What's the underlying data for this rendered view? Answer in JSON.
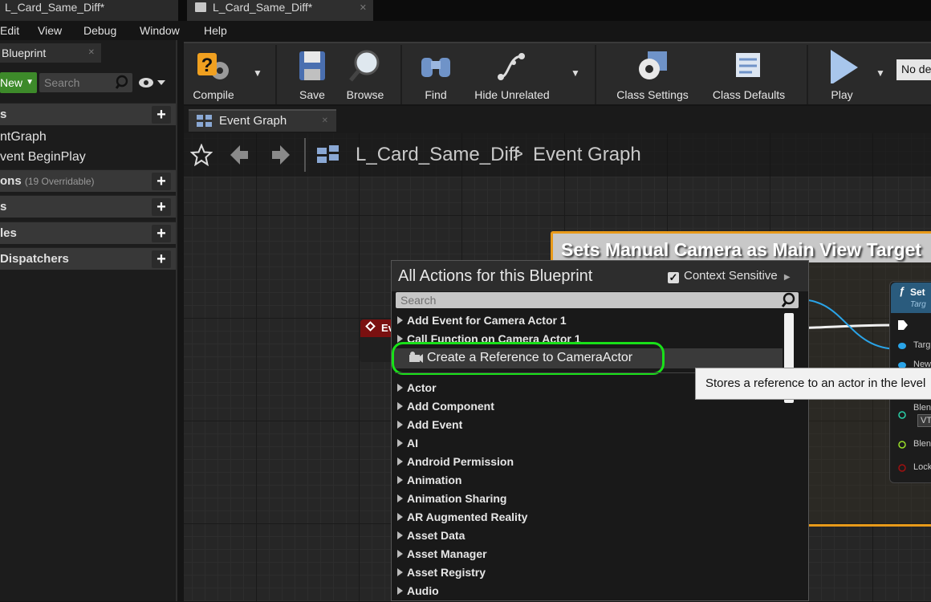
{
  "doc_tabs": [
    {
      "label": "L_Card_Same_Diff*"
    },
    {
      "label": "L_Card_Same_Diff*"
    }
  ],
  "menu": [
    "Edit",
    "View",
    "Debug",
    "Window",
    "Help"
  ],
  "left_panel": {
    "tab_label": "Blueprint",
    "new_label": "New",
    "search_placeholder": "Search",
    "sections": [
      {
        "label": "s"
      },
      {
        "label": "ons",
        "sub": "(19 Overridable)"
      },
      {
        "label": "s"
      },
      {
        "label": "les"
      },
      {
        "label": "Dispatchers"
      }
    ],
    "graph_items": [
      "ntGraph",
      "vent BeginPlay"
    ]
  },
  "toolbar": {
    "buttons": [
      {
        "label": "Compile",
        "icon": "compile-icon"
      },
      {
        "label": "Save",
        "icon": "save-icon"
      },
      {
        "label": "Browse",
        "icon": "browse-icon"
      },
      {
        "label": "Find",
        "icon": "find-icon"
      },
      {
        "label": "Hide Unrelated",
        "icon": "hide-unrelated-icon"
      },
      {
        "label": "Class Settings",
        "icon": "class-settings-icon"
      },
      {
        "label": "Class Defaults",
        "icon": "class-defaults-icon"
      },
      {
        "label": "Play",
        "icon": "play-icon"
      }
    ],
    "debug_filter": "No de"
  },
  "graph_tab": {
    "label": "Event Graph"
  },
  "breadcrumb": {
    "root": "L_Card_Same_Diff",
    "separator": ">",
    "current": "Event Graph"
  },
  "graph": {
    "comment_title": "Sets Manual Camera as Main View Target",
    "event_node_label": "Ev",
    "set_node": {
      "title": "Set",
      "subtitle": "Targ",
      "pins": [
        "Targ",
        "New",
        "Blen",
        "VT",
        "Blen",
        "Lock"
      ]
    }
  },
  "action_menu": {
    "title": "All Actions for this Blueprint",
    "context_sensitive_label": "Context Sensitive",
    "context_sensitive_checked": true,
    "search_placeholder": "Search",
    "top_items": [
      "Add Event for Camera Actor 1",
      "Call Function on Camera Actor 1"
    ],
    "selected_item": "Create a Reference to CameraActor",
    "categories": [
      "Actor",
      "Add Component",
      "Add Event",
      "AI",
      "Android Permission",
      "Animation",
      "Animation Sharing",
      "AR Augmented Reality",
      "Asset Data",
      "Asset Manager",
      "Asset Registry",
      "Audio"
    ]
  },
  "tooltip": {
    "text": "Stores a reference to an actor in the level"
  },
  "colors": {
    "comment_border": "#e89a1a",
    "highlight_ring": "#19e019",
    "new_button": "#3d8a2a",
    "event_node_header": "#7a1010",
    "function_node_header": "#2a5b7d"
  }
}
